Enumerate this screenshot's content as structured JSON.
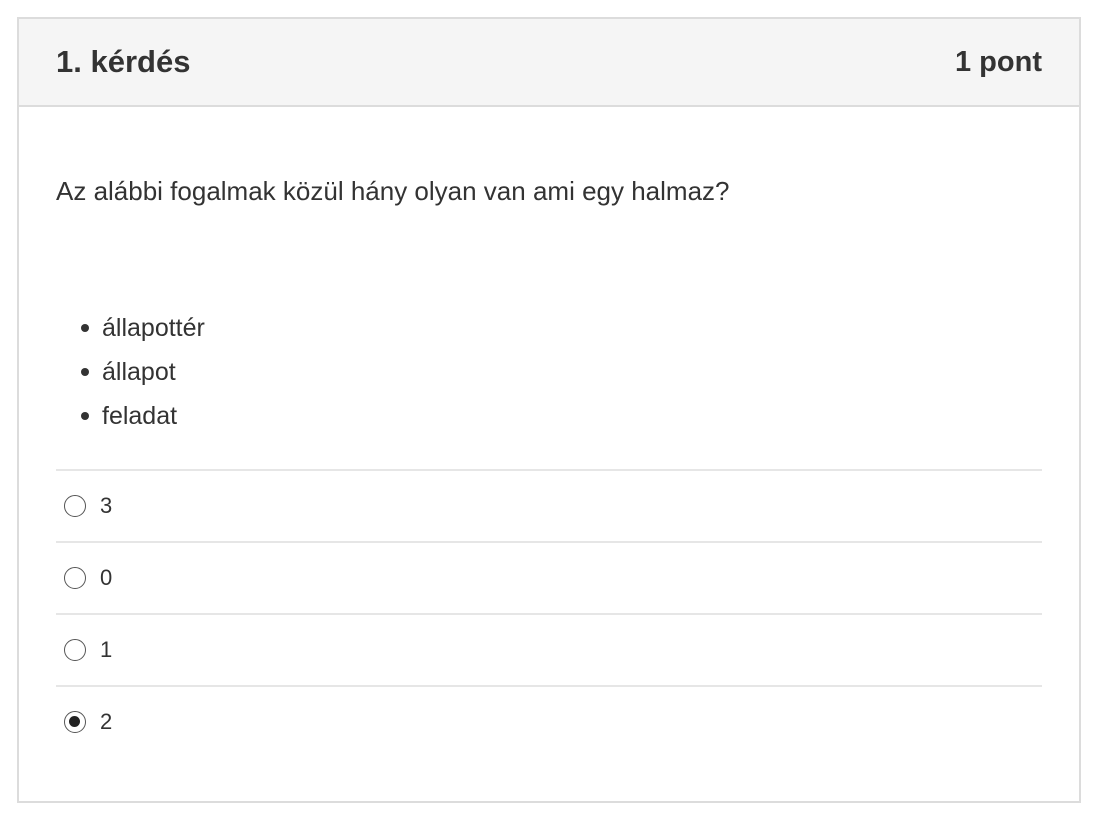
{
  "question": {
    "title": "1. kérdés",
    "points": "1 pont",
    "text": "Az alábbi fogalmak közül hány olyan van ami egy halmaz?",
    "items": [
      "állapottér",
      "állapot",
      "feladat"
    ]
  },
  "answers": [
    {
      "label": "3",
      "selected": false
    },
    {
      "label": "0",
      "selected": false
    },
    {
      "label": "1",
      "selected": false
    },
    {
      "label": "2",
      "selected": true
    }
  ]
}
